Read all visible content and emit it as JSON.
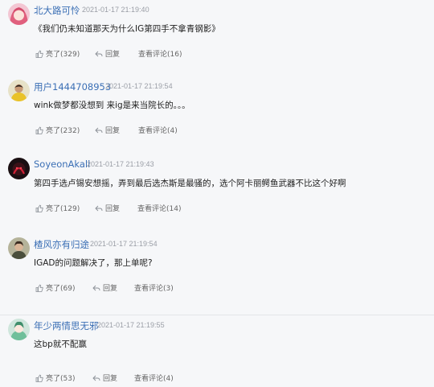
{
  "comments": [
    {
      "username": "北大路可怜",
      "time": "2021-01-17 21:19:40",
      "text": "《我们仍未知道那天为什么IG第四手不拿青钢影》",
      "like_label": "亮了(329)",
      "reply_label": "回复",
      "view_label": "查看评论(16)",
      "avatar_icon": "anime-pink-hair-avatar"
    },
    {
      "username": "用户1444708953",
      "time": "2021-01-17 21:19:54",
      "text": "wink做梦都没想到 来ig是来当院长的。。。",
      "like_label": "亮了(232)",
      "reply_label": "回复",
      "view_label": "查看评论(4)",
      "avatar_icon": "yellow-jersey-avatar"
    },
    {
      "username": "SoyeonAkali",
      "time": "2021-01-17 21:19:43",
      "text": "第四手选卢锡安想摇，弄到最后选杰斯是最骚的，选个阿卡丽鳄鱼武器不比这个好啊",
      "like_label": "亮了(129)",
      "reply_label": "回复",
      "view_label": "查看评论(14)",
      "avatar_icon": "dark-red-character-avatar"
    },
    {
      "username": "楂风亦有归途",
      "time": "2021-01-17 21:19:54",
      "text": "IGAD的问题解决了，那上单呢?",
      "like_label": "亮了(69)",
      "reply_label": "回复",
      "view_label": "查看评论(3)",
      "avatar_icon": "portrait-avatar"
    },
    {
      "username": "年少两情思无邪",
      "time": "2021-01-17 21:19:55",
      "text": "这bp就不配赢",
      "like_label": "亮了(53)",
      "reply_label": "回复",
      "view_label": "查看评论(4)",
      "avatar_icon": "anime-green-avatar"
    }
  ]
}
